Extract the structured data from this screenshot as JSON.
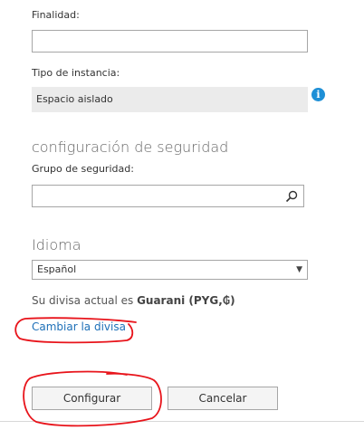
{
  "purpose": {
    "label": "Finalidad:",
    "value": ""
  },
  "instance_type": {
    "label": "Tipo de instancia:",
    "value": "Espacio aislado",
    "info_icon": "info-icon",
    "info_glyph": "i"
  },
  "security": {
    "heading": "configuración de seguridad",
    "group_label": "Grupo de seguridad:",
    "group_value": "",
    "search_icon": "search-icon"
  },
  "language": {
    "heading": "Idioma",
    "selected": "Español",
    "arrow_glyph": "▼"
  },
  "currency": {
    "prefix": "Su divisa actual es ",
    "name": "Guarani (PYG,₲)",
    "change_link": "Cambiar la divisa"
  },
  "actions": {
    "configure_label": "Configurar",
    "cancel_label": "Cancelar"
  },
  "colors": {
    "link": "#1e70b8",
    "info_icon": "#1e8fd6",
    "annotation": "#e8141b"
  }
}
